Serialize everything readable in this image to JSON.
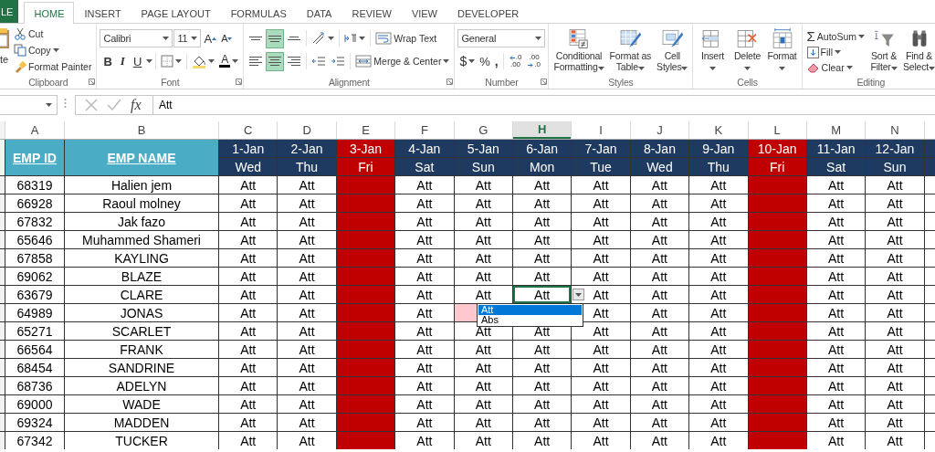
{
  "tabs": [
    {
      "label": "LE",
      "kind": "file",
      "selected": false
    },
    {
      "label": "HOME",
      "kind": "tab",
      "selected": true
    },
    {
      "label": "INSERT",
      "kind": "tab",
      "selected": false
    },
    {
      "label": "PAGE LAYOUT",
      "kind": "tab",
      "selected": false
    },
    {
      "label": "FORMULAS",
      "kind": "tab",
      "selected": false
    },
    {
      "label": "DATA",
      "kind": "tab",
      "selected": false
    },
    {
      "label": "REVIEW",
      "kind": "tab",
      "selected": false
    },
    {
      "label": "VIEW",
      "kind": "tab",
      "selected": false
    },
    {
      "label": "DEVELOPER",
      "kind": "tab",
      "selected": false
    }
  ],
  "ribbon": {
    "clipboard": {
      "title": "Clipboard",
      "paste": "te",
      "cut": "Cut",
      "copy": "Copy",
      "format_painter": "Format Painter"
    },
    "font": {
      "title": "Font",
      "name": "Calibri",
      "size": "11",
      "grow": "A",
      "shrink": "A",
      "bold": "B",
      "italic": "I",
      "underline": "U",
      "font_color": "A"
    },
    "alignment": {
      "title": "Alignment",
      "vertical": [
        {
          "on": false
        },
        {
          "on": true
        },
        {
          "on": false
        }
      ],
      "horizontal": [
        {
          "on": false
        },
        {
          "on": true
        },
        {
          "on": false
        }
      ],
      "wrap_text": "Wrap Text",
      "merge": "Merge & Center"
    },
    "number": {
      "title": "Number",
      "format": "General",
      "currency": "$",
      "percent": "%",
      "comma": ",",
      "increase_decimal": [
        ".0",
        ".00"
      ],
      "decrease_decimal": [
        ".00",
        ".0"
      ]
    },
    "styles": {
      "title": "Styles",
      "buttons": [
        {
          "kind": "conditional",
          "lines": [
            "Conditional",
            "Formatting"
          ]
        },
        {
          "kind": "table",
          "lines": [
            "Format as",
            "Table"
          ]
        },
        {
          "kind": "cell",
          "lines": [
            "Cell",
            "Styles"
          ]
        }
      ]
    },
    "cells": {
      "title": "Cells",
      "buttons": [
        {
          "kind": "insert",
          "label": "Insert"
        },
        {
          "kind": "delete",
          "label": "Delete"
        },
        {
          "kind": "format",
          "label": "Format"
        }
      ]
    },
    "editing": {
      "title": "Editing",
      "autosum_symbol": "Σ",
      "autosum": "AutoSum",
      "fill": "Fill",
      "clear": "Clear",
      "sort": [
        "Sort &",
        "Filter"
      ],
      "find": [
        "Find &",
        "Select"
      ]
    }
  },
  "formula_bar": {
    "function_button": "fx",
    "value": "Att"
  },
  "sheet": {
    "columns": [
      {
        "letter": "A",
        "selected": false
      },
      {
        "letter": "B",
        "selected": false
      },
      {
        "letter": "C",
        "selected": false
      },
      {
        "letter": "D",
        "selected": false
      },
      {
        "letter": "E",
        "selected": false
      },
      {
        "letter": "F",
        "selected": false
      },
      {
        "letter": "G",
        "selected": false
      },
      {
        "letter": "H",
        "selected": true
      },
      {
        "letter": "I",
        "selected": false
      },
      {
        "letter": "J",
        "selected": false
      },
      {
        "letter": "K",
        "selected": false
      },
      {
        "letter": "L",
        "selected": false
      },
      {
        "letter": "M",
        "selected": false
      },
      {
        "letter": "N",
        "selected": false
      }
    ],
    "id_heading": "EMP ID",
    "name_heading": "EMP NAME",
    "days": [
      {
        "date": "1-Jan",
        "weekday": "Wed",
        "holiday": false
      },
      {
        "date": "2-Jan",
        "weekday": "Thu",
        "holiday": false
      },
      {
        "date": "3-Jan",
        "weekday": "Fri",
        "holiday": true
      },
      {
        "date": "4-Jan",
        "weekday": "Sat",
        "holiday": false
      },
      {
        "date": "5-Jan",
        "weekday": "Sun",
        "holiday": false
      },
      {
        "date": "6-Jan",
        "weekday": "Mon",
        "holiday": false
      },
      {
        "date": "7-Jan",
        "weekday": "Tue",
        "holiday": false
      },
      {
        "date": "8-Jan",
        "weekday": "Wed",
        "holiday": false
      },
      {
        "date": "9-Jan",
        "weekday": "Thu",
        "holiday": false
      },
      {
        "date": "10-Jan",
        "weekday": "Fri",
        "holiday": true
      },
      {
        "date": "11-Jan",
        "weekday": "Sat",
        "holiday": false
      },
      {
        "date": "12-Jan",
        "weekday": "Sun",
        "holiday": false
      }
    ],
    "rows": [
      {
        "id": "68319",
        "name": "Halien jem",
        "active": false,
        "marks": [
          {
            "text": "Att",
            "flagged": false
          },
          {
            "text": "Att",
            "flagged": false
          },
          {
            "flagged": false
          },
          {
            "text": "Att",
            "flagged": false
          },
          {
            "text": "Att",
            "flagged": false
          },
          {
            "text": "Att",
            "flagged": false
          },
          {
            "text": "Att",
            "flagged": false
          },
          {
            "text": "Att",
            "flagged": false
          },
          {
            "text": "Att",
            "flagged": false
          },
          {
            "flagged": false
          },
          {
            "text": "Att",
            "flagged": false
          },
          {
            "text": "Att",
            "flagged": false
          }
        ]
      },
      {
        "id": "66928",
        "name": "Raoul molney",
        "active": false,
        "marks": [
          {
            "text": "Att",
            "flagged": false
          },
          {
            "text": "Att",
            "flagged": false
          },
          {
            "flagged": false
          },
          {
            "text": "Att",
            "flagged": false
          },
          {
            "text": "Att",
            "flagged": false
          },
          {
            "text": "Att",
            "flagged": false
          },
          {
            "text": "Att",
            "flagged": false
          },
          {
            "text": "Att",
            "flagged": false
          },
          {
            "text": "Att",
            "flagged": false
          },
          {
            "flagged": false
          },
          {
            "text": "Att",
            "flagged": false
          },
          {
            "text": "Att",
            "flagged": false
          }
        ]
      },
      {
        "id": "67832",
        "name": "Jak fazo",
        "active": false,
        "marks": [
          {
            "text": "Att",
            "flagged": false
          },
          {
            "text": "Att",
            "flagged": false
          },
          {
            "flagged": false
          },
          {
            "text": "Att",
            "flagged": false
          },
          {
            "text": "Att",
            "flagged": false
          },
          {
            "text": "Att",
            "flagged": false
          },
          {
            "text": "Att",
            "flagged": false
          },
          {
            "text": "Att",
            "flagged": false
          },
          {
            "text": "Att",
            "flagged": false
          },
          {
            "flagged": false
          },
          {
            "text": "Att",
            "flagged": false
          },
          {
            "text": "Att",
            "flagged": false
          }
        ]
      },
      {
        "id": "65646",
        "name": "Muhammed Shameri",
        "active": false,
        "marks": [
          {
            "text": "Att",
            "flagged": false
          },
          {
            "text": "Att",
            "flagged": false
          },
          {
            "flagged": false
          },
          {
            "text": "Att",
            "flagged": false
          },
          {
            "text": "Att",
            "flagged": false
          },
          {
            "text": "Att",
            "flagged": false
          },
          {
            "text": "Att",
            "flagged": false
          },
          {
            "text": "Att",
            "flagged": false
          },
          {
            "text": "Att",
            "flagged": false
          },
          {
            "flagged": false
          },
          {
            "text": "Att",
            "flagged": false
          },
          {
            "text": "Att",
            "flagged": false
          }
        ]
      },
      {
        "id": "67858",
        "name": "KAYLING",
        "active": false,
        "marks": [
          {
            "text": "Att",
            "flagged": false
          },
          {
            "text": "Att",
            "flagged": false
          },
          {
            "flagged": false
          },
          {
            "text": "Att",
            "flagged": false
          },
          {
            "text": "Att",
            "flagged": false
          },
          {
            "text": "Att",
            "flagged": false
          },
          {
            "text": "Att",
            "flagged": false
          },
          {
            "text": "Att",
            "flagged": false
          },
          {
            "text": "Att",
            "flagged": false
          },
          {
            "flagged": false
          },
          {
            "text": "Att",
            "flagged": false
          },
          {
            "text": "Att",
            "flagged": false
          }
        ]
      },
      {
        "id": "69062",
        "name": "BLAZE",
        "active": false,
        "marks": [
          {
            "text": "Att",
            "flagged": false
          },
          {
            "text": "Att",
            "flagged": false
          },
          {
            "flagged": false
          },
          {
            "text": "Att",
            "flagged": false
          },
          {
            "text": "Att",
            "flagged": false
          },
          {
            "text": "Att",
            "flagged": false
          },
          {
            "text": "Att",
            "flagged": false
          },
          {
            "text": "Att",
            "flagged": false
          },
          {
            "text": "Att",
            "flagged": false
          },
          {
            "flagged": false
          },
          {
            "text": "Att",
            "flagged": false
          },
          {
            "text": "Att",
            "flagged": false
          }
        ]
      },
      {
        "id": "63679",
        "name": "CLARE",
        "active": true,
        "marks": [
          {
            "text": "Att",
            "flagged": false
          },
          {
            "text": "Att",
            "flagged": false
          },
          {
            "flagged": false
          },
          {
            "text": "Att",
            "flagged": false
          },
          {
            "text": "Att",
            "flagged": false
          },
          {
            "text": "Att",
            "flagged": false
          },
          {
            "text": "Att",
            "flagged": false
          },
          {
            "text": "Att",
            "flagged": false
          },
          {
            "text": "Att",
            "flagged": false
          },
          {
            "flagged": false
          },
          {
            "text": "Att",
            "flagged": false
          },
          {
            "text": "Att",
            "flagged": false
          }
        ]
      },
      {
        "id": "64989",
        "name": "JONAS",
        "active": false,
        "marks": [
          {
            "text": "Att",
            "flagged": false
          },
          {
            "text": "Att",
            "flagged": false
          },
          {
            "flagged": false
          },
          {
            "text": "Att",
            "flagged": false
          },
          {
            "flagged": true
          },
          {
            "flagged": false
          },
          {
            "text": "Att",
            "flagged": false
          },
          {
            "text": "Att",
            "flagged": false
          },
          {
            "text": "Att",
            "flagged": false
          },
          {
            "flagged": false
          },
          {
            "text": "Att",
            "flagged": false
          },
          {
            "text": "Att",
            "flagged": false
          }
        ]
      },
      {
        "id": "65271",
        "name": "SCARLET",
        "active": false,
        "marks": [
          {
            "text": "Att",
            "flagged": false
          },
          {
            "text": "Att",
            "flagged": false
          },
          {
            "flagged": false
          },
          {
            "text": "Att",
            "flagged": false
          },
          {
            "text": "Att",
            "flagged": false
          },
          {
            "text": "Att",
            "flagged": false
          },
          {
            "text": "Att",
            "flagged": false
          },
          {
            "text": "Att",
            "flagged": false
          },
          {
            "text": "Att",
            "flagged": false
          },
          {
            "flagged": false
          },
          {
            "text": "Att",
            "flagged": false
          },
          {
            "text": "Att",
            "flagged": false
          }
        ]
      },
      {
        "id": "66564",
        "name": "FRANK",
        "active": false,
        "marks": [
          {
            "text": "Att",
            "flagged": false
          },
          {
            "text": "Att",
            "flagged": false
          },
          {
            "flagged": false
          },
          {
            "text": "Att",
            "flagged": false
          },
          {
            "text": "Att",
            "flagged": false
          },
          {
            "text": "Att",
            "flagged": false
          },
          {
            "text": "Att",
            "flagged": false
          },
          {
            "text": "Att",
            "flagged": false
          },
          {
            "text": "Att",
            "flagged": false
          },
          {
            "flagged": false
          },
          {
            "text": "Att",
            "flagged": false
          },
          {
            "text": "Att",
            "flagged": false
          }
        ]
      },
      {
        "id": "68454",
        "name": "SANDRINE",
        "active": false,
        "marks": [
          {
            "text": "Att",
            "flagged": false
          },
          {
            "text": "Att",
            "flagged": false
          },
          {
            "flagged": false
          },
          {
            "text": "Att",
            "flagged": false
          },
          {
            "text": "Att",
            "flagged": false
          },
          {
            "text": "Att",
            "flagged": false
          },
          {
            "text": "Att",
            "flagged": false
          },
          {
            "text": "Att",
            "flagged": false
          },
          {
            "text": "Att",
            "flagged": false
          },
          {
            "flagged": false
          },
          {
            "text": "Att",
            "flagged": false
          },
          {
            "text": "Att",
            "flagged": false
          }
        ]
      },
      {
        "id": "68736",
        "name": "ADELYN",
        "active": false,
        "marks": [
          {
            "text": "Att",
            "flagged": false
          },
          {
            "text": "Att",
            "flagged": false
          },
          {
            "flagged": false
          },
          {
            "text": "Att",
            "flagged": false
          },
          {
            "text": "Att",
            "flagged": false
          },
          {
            "text": "Att",
            "flagged": false
          },
          {
            "text": "Att",
            "flagged": false
          },
          {
            "text": "Att",
            "flagged": false
          },
          {
            "text": "Att",
            "flagged": false
          },
          {
            "flagged": false
          },
          {
            "text": "Att",
            "flagged": false
          },
          {
            "text": "Att",
            "flagged": false
          }
        ]
      },
      {
        "id": "69000",
        "name": "WADE",
        "active": false,
        "marks": [
          {
            "text": "Att",
            "flagged": false
          },
          {
            "text": "Att",
            "flagged": false
          },
          {
            "flagged": false
          },
          {
            "text": "Att",
            "flagged": false
          },
          {
            "text": "Att",
            "flagged": false
          },
          {
            "text": "Att",
            "flagged": false
          },
          {
            "text": "Att",
            "flagged": false
          },
          {
            "text": "Att",
            "flagged": false
          },
          {
            "text": "Att",
            "flagged": false
          },
          {
            "flagged": false
          },
          {
            "text": "Att",
            "flagged": false
          },
          {
            "text": "Att",
            "flagged": false
          }
        ]
      },
      {
        "id": "69324",
        "name": "MADDEN",
        "active": false,
        "marks": [
          {
            "text": "Att",
            "flagged": false
          },
          {
            "text": "Att",
            "flagged": false
          },
          {
            "flagged": false
          },
          {
            "text": "Att",
            "flagged": false
          },
          {
            "text": "Att",
            "flagged": false
          },
          {
            "text": "Att",
            "flagged": false
          },
          {
            "text": "Att",
            "flagged": false
          },
          {
            "text": "Att",
            "flagged": false
          },
          {
            "text": "Att",
            "flagged": false
          },
          {
            "flagged": false
          },
          {
            "text": "Att",
            "flagged": false
          },
          {
            "text": "Att",
            "flagged": false
          }
        ]
      },
      {
        "id": "67342",
        "name": "TUCKER",
        "active": false,
        "marks": [
          {
            "text": "Att",
            "flagged": false
          },
          {
            "text": "Att",
            "flagged": false
          },
          {
            "flagged": false
          },
          {
            "text": "Att",
            "flagged": false
          },
          {
            "text": "Att",
            "flagged": false
          },
          {
            "text": "Att",
            "flagged": false
          },
          {
            "text": "Att",
            "flagged": false
          },
          {
            "text": "Att",
            "flagged": false
          },
          {
            "text": "Att",
            "flagged": false
          },
          {
            "flagged": false
          },
          {
            "text": "Att",
            "flagged": false
          },
          {
            "text": "Att",
            "flagged": false
          }
        ]
      }
    ],
    "dropdown": {
      "options": [
        {
          "label": "Att",
          "selected": true
        },
        {
          "label": "Abs",
          "selected": false
        }
      ]
    }
  }
}
